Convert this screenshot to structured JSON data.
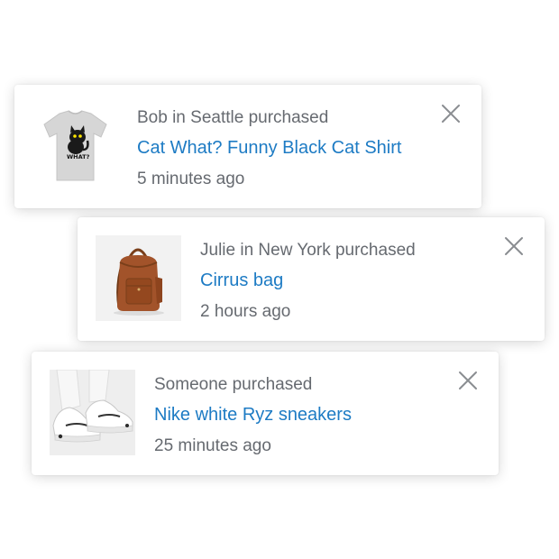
{
  "notifications": [
    {
      "who": "Bob in Seattle purchased",
      "product": "Cat What? Funny Black Cat Shirt",
      "when": "5 minutes ago",
      "thumb_icon": "cat-shirt-image",
      "thumb_text": "WHAT?"
    },
    {
      "who": "Julie in New York purchased",
      "product": "Cirrus bag",
      "when": "2 hours ago",
      "thumb_icon": "backpack-image"
    },
    {
      "who": "Someone purchased",
      "product": "Nike white Ryz sneakers",
      "when": "25 minutes ago",
      "thumb_icon": "sneakers-image"
    }
  ],
  "colors": {
    "link": "#1d7bc4",
    "muted_text": "#666a70",
    "close_icon": "#8a8d91"
  },
  "close_icon": "close-icon"
}
